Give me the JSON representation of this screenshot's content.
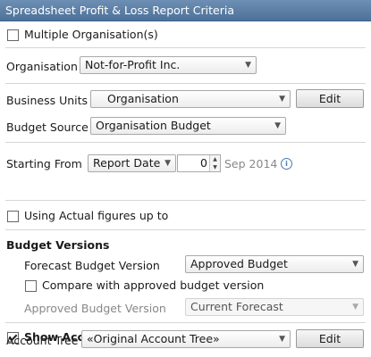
{
  "title": "Spreadsheet Profit & Loss  Report Criteria",
  "multiple_orgs": {
    "label": "Multiple Organisation(s)",
    "checked": false
  },
  "organisation": {
    "label": "Organisation",
    "value": "Not-for-Profit Inc."
  },
  "business_units": {
    "label": "Business Units",
    "value": "Organisation",
    "edit_label": "Edit"
  },
  "budget_source": {
    "label": "Budget Source",
    "value": "Organisation Budget"
  },
  "starting_from": {
    "label": "Starting From",
    "mode": "Report Date",
    "offset": "0",
    "date": "Sep 2014"
  },
  "use_actual": {
    "label": "Using Actual figures up to",
    "checked": false
  },
  "budget_versions": {
    "heading": "Budget Versions",
    "forecast_label": "Forecast Budget Version",
    "forecast_value": "Approved Budget",
    "compare_label": "Compare with approved budget version",
    "compare_checked": false,
    "approved_label": "Approved Budget Version",
    "approved_value": "Current Forecast"
  },
  "show_accounts": {
    "label": "Show Accounts",
    "checked": true
  },
  "account_tree": {
    "label": "Account Tree",
    "value": "«Original Account Tree»",
    "edit_label": "Edit"
  }
}
